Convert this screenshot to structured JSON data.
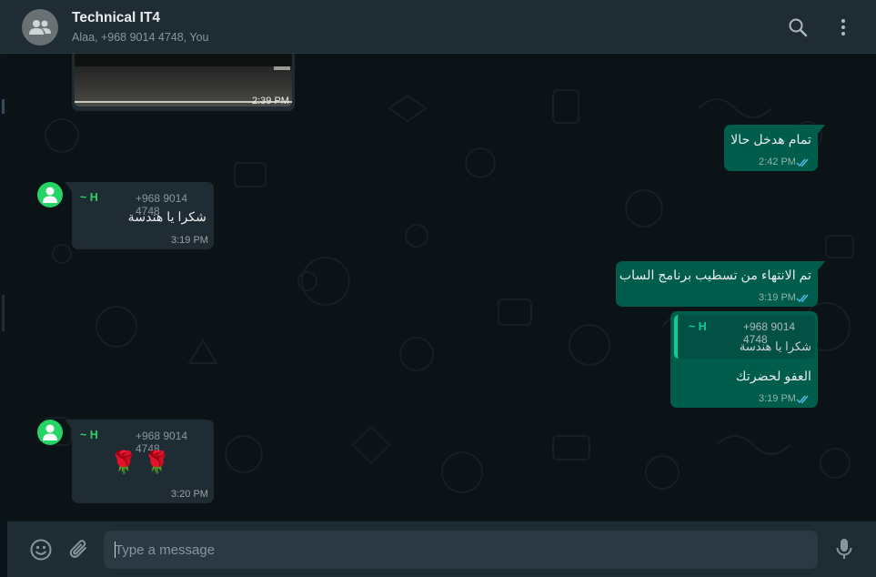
{
  "chat": {
    "title": "Technical IT4",
    "subtitle": "Alaa, +968 9014 4748, You"
  },
  "icons": {
    "group_avatar": "group-icon",
    "search": "search-icon",
    "menu": "more-vertical-icon",
    "avatar": "person-icon",
    "emoji": "emoji-icon",
    "attach": "paperclip-icon",
    "mic": "microphone-icon",
    "read": "double-check-icon"
  },
  "colors": {
    "header_bg": "#202c33",
    "chat_bg": "#0b141a",
    "incoming_bubble": "#202c33",
    "outgoing_bubble": "#005c4b",
    "accent": "#25d366",
    "read_ticks": "#53bdeb"
  },
  "messages": [
    {
      "type": "image",
      "direction": "in",
      "time": "2:39 PM"
    },
    {
      "direction": "out",
      "text": "تمام هدخل حالا",
      "time": "2:42 PM",
      "status": "read"
    },
    {
      "direction": "in",
      "sender_name": "~ H",
      "sender_phone": "+968 9014 4748",
      "text": "شكرا يا هندسة",
      "time": "3:19 PM"
    },
    {
      "direction": "out",
      "text": "تم الانتهاء من تسطيب برنامج الساب",
      "time": "3:19 PM",
      "status": "read"
    },
    {
      "direction": "out",
      "quoted": {
        "sender_name": "~ H",
        "sender_phone": "+968 9014 4748",
        "text": "شكرا يا هندسة"
      },
      "text": "العفو لحضرتك",
      "time": "3:19 PM",
      "status": "read"
    },
    {
      "direction": "in",
      "sender_name": "~ H",
      "sender_phone": "+968 9014 4748",
      "text": "🌹 🌹",
      "time": "3:20 PM"
    }
  ],
  "composer": {
    "placeholder": "Type a message",
    "value": ""
  }
}
